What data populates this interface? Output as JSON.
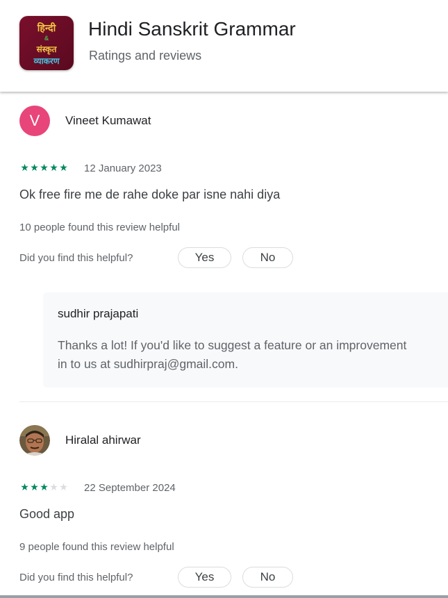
{
  "header": {
    "app_title": "Hindi Sanskrit Grammar",
    "subtitle": "Ratings and reviews",
    "icon": {
      "line1": "हिन्दी",
      "amp": "&",
      "line2": "संस्कृत",
      "line3": "व्याकरण",
      "background": "#6e0d27"
    }
  },
  "reviews": [
    {
      "avatar_letter": "V",
      "avatar_color": "#e8457a",
      "name": "Vineet Kumawat",
      "rating": 5,
      "date": "12 January 2023",
      "text": "Ok free fire me de rahe doke par isne nahi diya",
      "helpful_count": "10 people found this review helpful",
      "helpful_question": "Did you find this helpful?",
      "yes_label": "Yes",
      "no_label": "No",
      "reply": {
        "author": "sudhir prajapati",
        "text": "Thanks a lot! If you'd like to suggest a feature or an improvement\nin to us at sudhirpraj@gmail.com."
      }
    },
    {
      "avatar_type": "photo",
      "name": "Hiralal ahirwar",
      "rating": 3,
      "date": "22 September 2024",
      "text": "Good app",
      "helpful_count": "9 people found this review helpful",
      "helpful_question": "Did you find this helpful?",
      "yes_label": "Yes",
      "no_label": "No"
    }
  ],
  "colors": {
    "star_on": "#01875f",
    "star_off": "#dadce0",
    "reply_background": "#f8f9fa"
  }
}
